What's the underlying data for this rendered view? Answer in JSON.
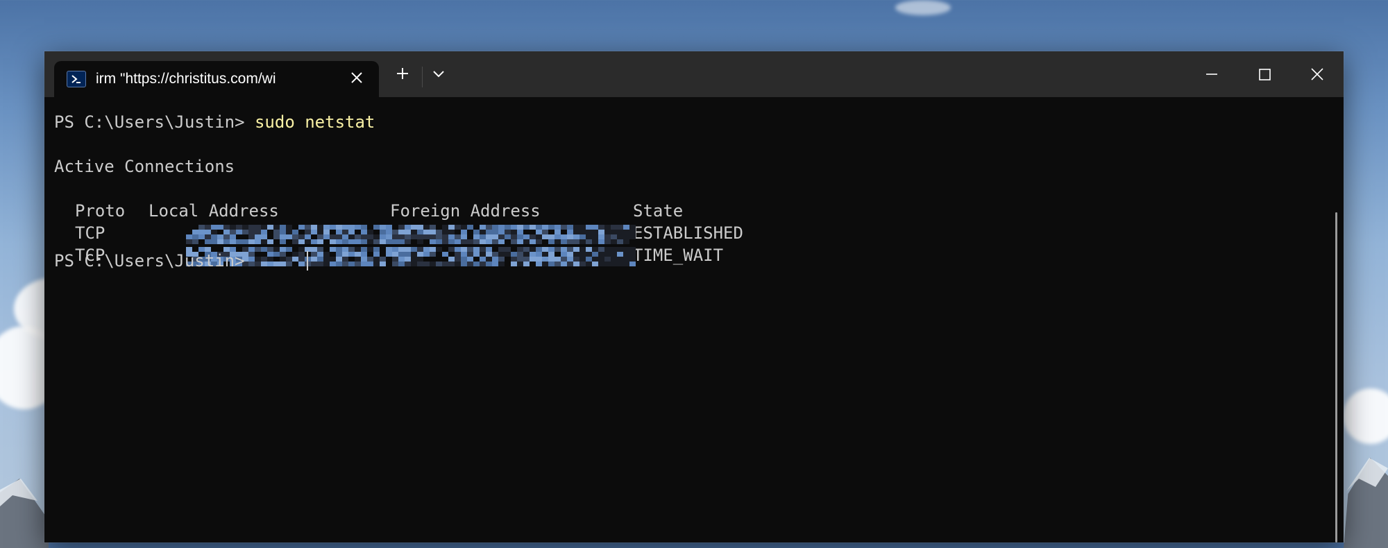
{
  "colors": {
    "terminal_bg": "#0c0c0c",
    "titlebar_bg": "#2b2b2b",
    "text": "#cccccc",
    "command": "#f9f1a5",
    "redaction": "#5d85bd"
  },
  "window": {
    "tab_title": "irm \"https://christitus.com/wi",
    "tab_icon": "powershell-icon",
    "buttons": {
      "close_tab": "close-icon",
      "new_tab": "plus-icon",
      "dropdown": "chevron-down-icon",
      "minimize": "minimize-icon",
      "maximize": "maximize-icon",
      "close": "close-icon"
    }
  },
  "terminal": {
    "prompt": "PS C:\\Users\\Justin> ",
    "command": "sudo netstat",
    "heading": "Active Connections",
    "columns": [
      "Proto",
      "Local Address",
      "Foreign Address",
      "State"
    ],
    "rows": [
      {
        "proto": "TCP",
        "local": "[redacted]",
        "foreign": "[redacted]",
        "state": "ESTABLISHED"
      },
      {
        "proto": "TCP",
        "local": "[redacted]",
        "foreign": "[redacted]",
        "state": "TIME_WAIT"
      }
    ],
    "final_prompt": "PS C:\\Users\\Justin> "
  }
}
